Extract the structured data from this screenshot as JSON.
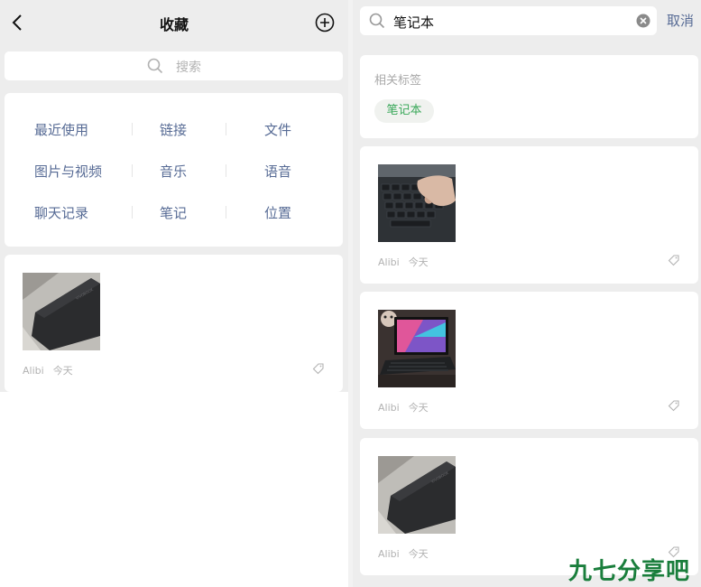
{
  "left": {
    "title": "收藏",
    "search_placeholder": "搜索",
    "categories": [
      "最近使用",
      "链接",
      "文件",
      "图片与视频",
      "音乐",
      "语音",
      "聊天记录",
      "笔记",
      "位置"
    ],
    "item": {
      "author": "Alibi",
      "date": "今天"
    }
  },
  "right": {
    "search_query": "笔记本",
    "cancel_label": "取消",
    "tags_title": "相关标签",
    "tag": "笔记本",
    "items": [
      {
        "author": "Alibi",
        "date": "今天"
      },
      {
        "author": "Alibi",
        "date": "今天"
      },
      {
        "author": "Alibi",
        "date": "今天"
      }
    ]
  },
  "watermark": "九七分享吧",
  "icons": [
    "back-icon",
    "add-icon",
    "search-icon",
    "clear-icon",
    "tag-icon"
  ],
  "colors": {
    "link_blue": "#576b95",
    "tag_green": "#3aa85a",
    "bg": "#ededed"
  }
}
